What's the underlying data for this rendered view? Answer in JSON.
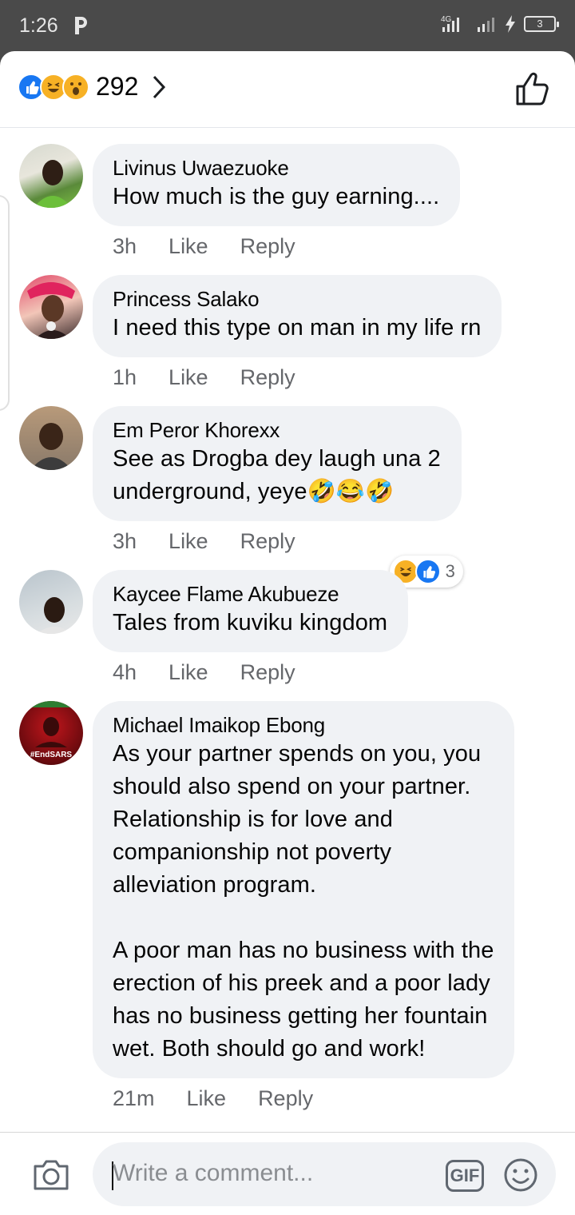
{
  "status_bar": {
    "time": "1:26",
    "network": "4G",
    "battery": "3"
  },
  "header": {
    "reaction_count": "292",
    "reactions": [
      "like",
      "haha",
      "wow"
    ]
  },
  "comments": [
    {
      "author": "Livinus Uwaezuoke",
      "text": "How much is the guy earning....",
      "time": "3h",
      "like": "Like",
      "reply": "Reply"
    },
    {
      "author": "Princess Salako",
      "text": "I need this type on man in my life rn",
      "time": "1h",
      "like": "Like",
      "reply": "Reply"
    },
    {
      "author": "Em Peror Khorexx",
      "text": "See as Drogba dey laugh una 2\nunderground, yeye🤣😂🤣",
      "time": "3h",
      "like": "Like",
      "reply": "Reply",
      "reaction_count": "3"
    },
    {
      "author": "Kaycee Flame Akubueze",
      "text": "Tales from kuviku kingdom",
      "time": "4h",
      "like": "Like",
      "reply": "Reply"
    },
    {
      "author": "Michael Imaikop Ebong",
      "text": "As your partner spends on you, you\nshould also spend on your partner.\nRelationship is for love and\ncompanionship not poverty\nalleviation program.\n\nA poor man has no business with the\nerection of his preek and a poor lady\nhas no business getting her fountain\nwet. Both should go and work!",
      "time": "21m",
      "like": "Like",
      "reply": "Reply",
      "avatar_text": "#EndSARS"
    }
  ],
  "composer": {
    "placeholder": "Write a comment...",
    "gif_label": "GIF"
  },
  "colors": {
    "accent": "#1877f2",
    "bubble": "#f0f2f5",
    "meta": "#65676b",
    "statusbar": "#4a4a4a"
  }
}
